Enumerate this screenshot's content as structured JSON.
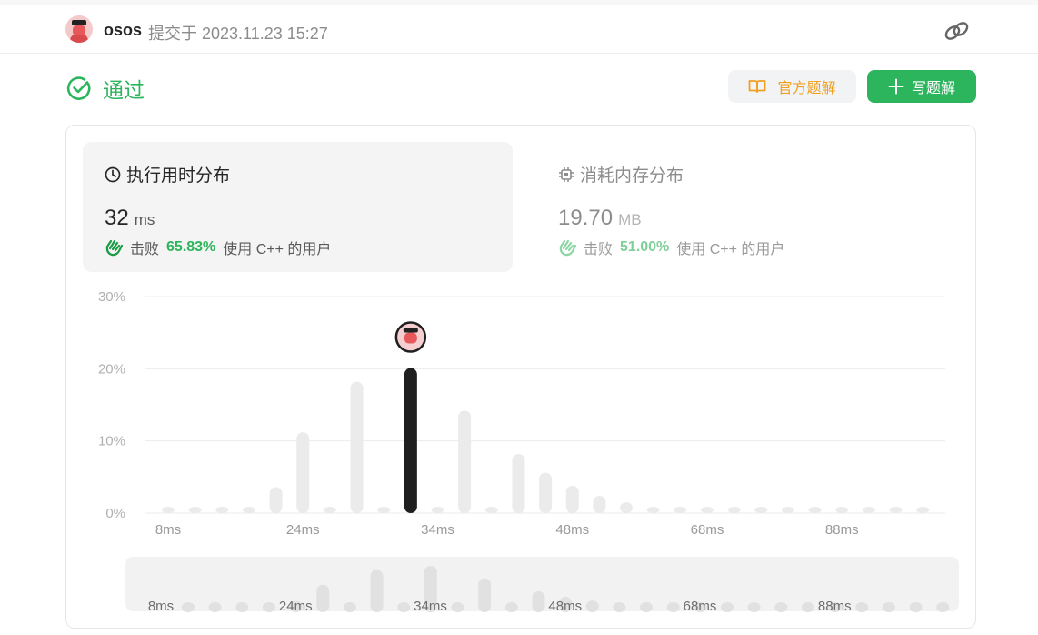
{
  "header": {
    "username": "osos",
    "submitted_text": "提交于 2023.11.23 15:27",
    "link_icon": "link-icon"
  },
  "status": {
    "label": "通过",
    "icon": "check-circle-icon",
    "color": "#2db55d"
  },
  "actions": {
    "official_solution": "官方题解",
    "write_solution": "写题解"
  },
  "runtime": {
    "title": "执行用时分布",
    "value": "32",
    "unit": "ms",
    "beat_prefix": "击败",
    "beat_pct": "65.83%",
    "beat_suffix": "使用 C++ 的用户"
  },
  "memory": {
    "title": "消耗内存分布",
    "value": "19.70",
    "unit": "MB",
    "beat_prefix": "击败",
    "beat_pct": "51.00%",
    "beat_suffix": "使用 C++ 的用户"
  },
  "chart_data": {
    "type": "bar",
    "title": "",
    "ylabel": "",
    "xlabel": "",
    "ylim": [
      0,
      30
    ],
    "y_ticks": [
      "0%",
      "10%",
      "20%",
      "30%"
    ],
    "y_tick_values": [
      0,
      10,
      20,
      30
    ],
    "x_ticks": [
      "8ms",
      "24ms",
      "34ms",
      "48ms",
      "68ms",
      "88ms"
    ],
    "x_tick_index": [
      0,
      5,
      10,
      15,
      20,
      25
    ],
    "values": [
      0.8,
      0.8,
      0.8,
      0.8,
      3.6,
      11.2,
      0.8,
      18.2,
      0.8,
      20.1,
      0.8,
      14.2,
      0.8,
      8.2,
      5.6,
      3.8,
      2.4,
      1.5,
      0.8,
      0.8,
      0.8,
      0.8,
      0.8,
      0.8,
      0.8,
      0.8,
      0.8,
      0.8,
      0.8
    ],
    "highlight_index": 9,
    "bar_color": "#ebebeb",
    "highlight_color": "#1f1f1f"
  }
}
